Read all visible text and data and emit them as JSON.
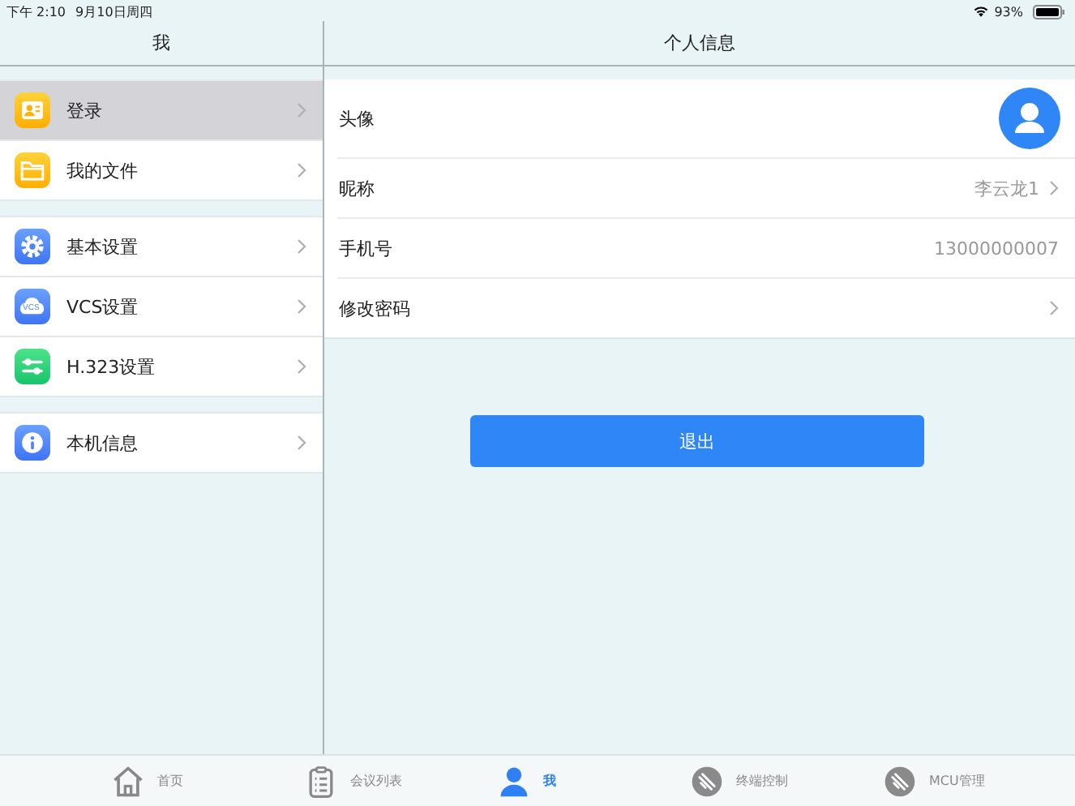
{
  "status_bar": {
    "time": "下午 2:10",
    "date": "9月10日周四",
    "battery": "93%"
  },
  "sidebar": {
    "title": "我",
    "groups": [
      [
        {
          "label": "登录",
          "kind": "login",
          "selected": true
        },
        {
          "label": "我的文件",
          "kind": "folder",
          "selected": false
        }
      ],
      [
        {
          "label": "基本设置",
          "kind": "gear",
          "selected": false
        },
        {
          "label": "VCS设置",
          "kind": "cloud",
          "icon_text": "VCS",
          "selected": false
        },
        {
          "label": "H.323设置",
          "kind": "sliders",
          "selected": false
        }
      ],
      [
        {
          "label": "本机信息",
          "kind": "info",
          "selected": false
        }
      ]
    ]
  },
  "detail": {
    "title": "个人信息",
    "rows": [
      {
        "kind": "avatar",
        "label": "头像"
      },
      {
        "kind": "value_link",
        "label": "昵称",
        "value": "李云龙1"
      },
      {
        "kind": "value",
        "label": "手机号",
        "value": "13000000007"
      },
      {
        "kind": "link",
        "label": "修改密码"
      }
    ],
    "logout_button": "退出"
  },
  "tab_bar": [
    {
      "label": "首页",
      "kind": "home",
      "selected": false
    },
    {
      "label": "会议列表",
      "kind": "clipboard",
      "selected": false
    },
    {
      "label": "我",
      "kind": "person",
      "selected": true
    },
    {
      "label": "终端控制",
      "kind": "disk",
      "selected": false
    },
    {
      "label": "MCU管理",
      "kind": "disk",
      "selected": false
    }
  ]
}
